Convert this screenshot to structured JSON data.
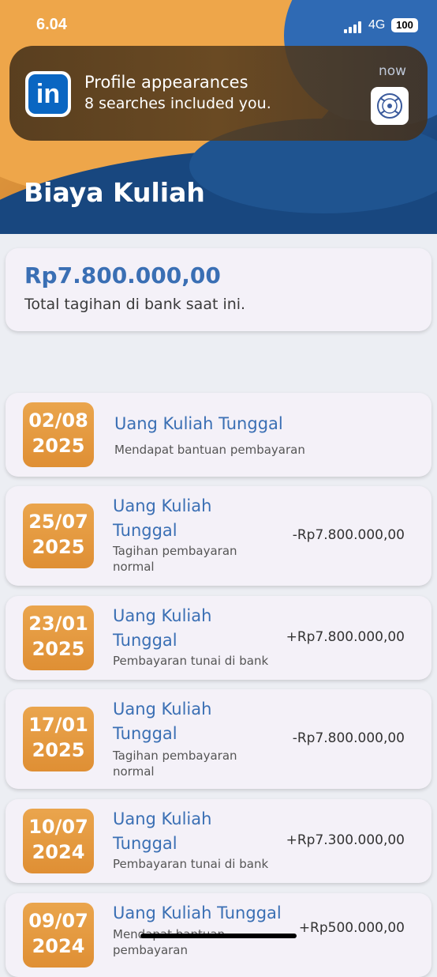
{
  "status": {
    "time": "6.04",
    "network": "4G",
    "battery": "100"
  },
  "notification": {
    "app_icon": "linkedin-icon",
    "title": "Profile appearances",
    "body": "8 searches included you.",
    "time": "now"
  },
  "header": {
    "title": "Biaya Kuliah"
  },
  "total": {
    "amount": "Rp7.800.000,00",
    "label": "Total tagihan di bank saat ini."
  },
  "colors": {
    "accent": "#3a6fb4",
    "badge": "#e49a3f",
    "header_blue": "#1a4a82"
  },
  "items": [
    {
      "day": "02/08",
      "year": "2025",
      "title": "Uang Kuliah Tunggal",
      "subtitle": "Mendapat bantuan pembayaran",
      "amount": ""
    },
    {
      "day": "25/07",
      "year": "2025",
      "title": "Uang Kuliah Tunggal",
      "subtitle": "Tagihan pembayaran normal",
      "amount": "-Rp7.800.000,00"
    },
    {
      "day": "23/01",
      "year": "2025",
      "title": "Uang Kuliah Tunggal",
      "subtitle": "Pembayaran tunai di bank",
      "amount": "+Rp7.800.000,00"
    },
    {
      "day": "17/01",
      "year": "2025",
      "title": "Uang Kuliah Tunggal",
      "subtitle": "Tagihan pembayaran normal",
      "amount": "-Rp7.800.000,00"
    },
    {
      "day": "10/07",
      "year": "2024",
      "title": "Uang Kuliah Tunggal",
      "subtitle": "Pembayaran tunai di bank",
      "amount": "+Rp7.300.000,00"
    },
    {
      "day": "09/07",
      "year": "2024",
      "title": "Uang Kuliah Tunggal",
      "subtitle": "Mendapat bantuan pembayaran",
      "amount": "+Rp500.000,00"
    }
  ]
}
